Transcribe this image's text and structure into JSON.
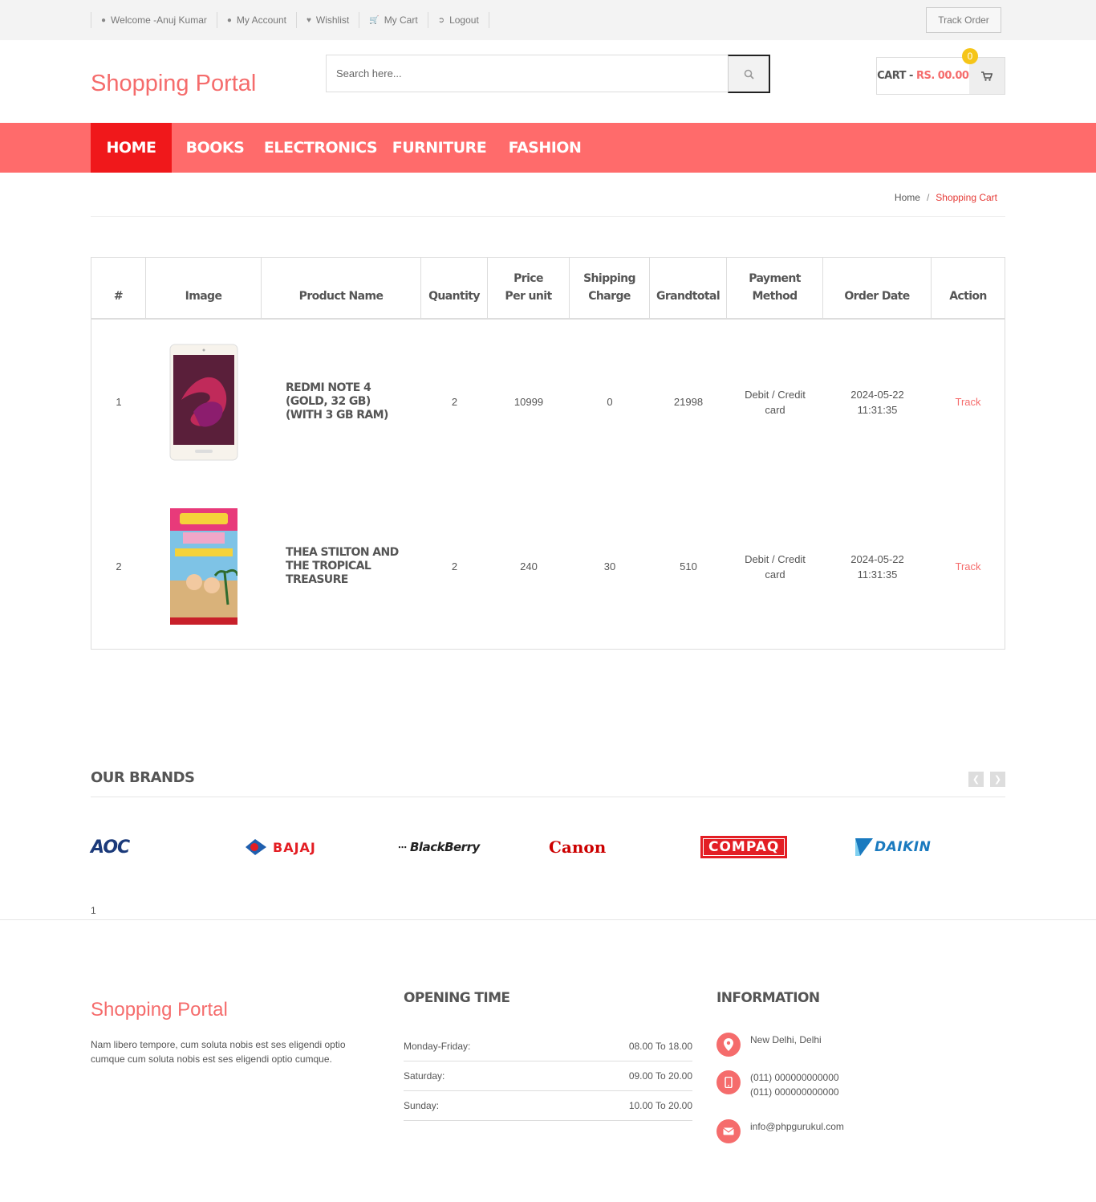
{
  "topbar": {
    "links": [
      {
        "icon": "user-icon",
        "label": "Welcome -Anuj Kumar"
      },
      {
        "icon": "user-icon",
        "label": "My Account"
      },
      {
        "icon": "heart-icon",
        "label": "Wishlist"
      },
      {
        "icon": "cart-icon",
        "label": "My Cart"
      },
      {
        "icon": "logout-icon",
        "label": "Logout"
      }
    ],
    "track_order": "Track Order"
  },
  "header": {
    "logo": "Shopping Portal",
    "search_placeholder": "Search here...",
    "cart_label": "CART -",
    "cart_amount": "RS. 00.00",
    "cart_count": "0"
  },
  "nav": {
    "items": [
      "HOME",
      "BOOKS",
      "ELECTRONICS",
      "FURNITURE",
      "FASHION"
    ],
    "active": "HOME"
  },
  "breadcrumb": {
    "home": "Home",
    "separator": "/",
    "current": "Shopping Cart"
  },
  "orders": {
    "headers": [
      "#",
      "Image",
      "Product Name",
      "Quantity",
      "Price Per unit",
      "Shipping Charge",
      "Grandtotal",
      "Payment Method",
      "Order Date",
      "Action"
    ],
    "rows": [
      {
        "num": "1",
        "image": "phone-image",
        "product": "REDMI NOTE 4 (GOLD, 32 GB) (WITH 3 GB RAM)",
        "qty": "2",
        "price": "10999",
        "shipping": "0",
        "total": "21998",
        "payment": "Debit / Credit card",
        "date": "2024-05-22 11:31:35",
        "action": "Track"
      },
      {
        "num": "2",
        "image": "book-image",
        "product": "THEA STILTON AND THE TROPICAL TREASURE",
        "qty": "2",
        "price": "240",
        "shipping": "30",
        "total": "510",
        "payment": "Debit / Credit card",
        "date": "2024-05-22 11:31:35",
        "action": "Track"
      }
    ]
  },
  "brands": {
    "title": "OUR BRANDS",
    "items": [
      {
        "name": "AOC",
        "color": "#1b3a7a"
      },
      {
        "name": "BAJAJ",
        "color": "#e31e24"
      },
      {
        "name": "BlackBerry",
        "color": "#222222"
      },
      {
        "name": "Canon",
        "color": "#cc0000"
      },
      {
        "name": "COMPAQ",
        "color": "#e31e24"
      },
      {
        "name": "DAIKIN",
        "color": "#1a7abf"
      }
    ],
    "page": "1"
  },
  "footer": {
    "logo": "Shopping Portal",
    "description": "Nam libero tempore, cum soluta nobis est ses eligendi optio cumque cum soluta nobis est ses eligendi optio cumque.",
    "opening_title": "OPENING TIME",
    "opening": [
      {
        "day": "Monday-Friday:",
        "time": "08.00 To 18.00"
      },
      {
        "day": "Saturday:",
        "time": "09.00 To 20.00"
      },
      {
        "day": "Sunday:",
        "time": "10.00 To 20.00"
      }
    ],
    "info_title": "INFORMATION",
    "address": "New Delhi, Delhi",
    "phone1": "(011) 000000000000",
    "phone2": "(011) 000000000000",
    "email": "info@phpgurukul.com"
  },
  "colors": {
    "accent": "#f56c6c",
    "nav": "#ff6b6b",
    "nav_active": "#f0181b",
    "badge": "#f5c518"
  }
}
